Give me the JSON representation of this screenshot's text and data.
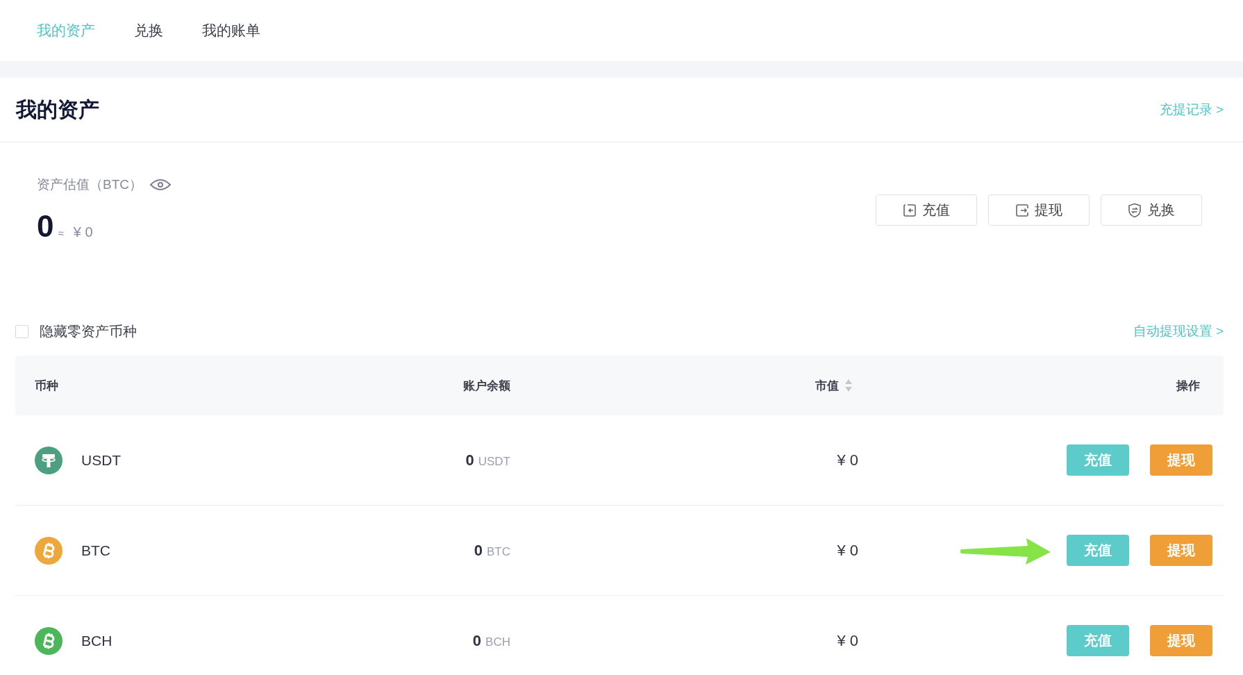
{
  "tabs": [
    {
      "label": "我的资产",
      "selected": true
    },
    {
      "label": "兑换",
      "selected": false
    },
    {
      "label": "我的账单",
      "selected": false
    }
  ],
  "header": {
    "title": "我的资产",
    "link": "充提记录 >"
  },
  "summary": {
    "label": "资产估值（BTC）",
    "amount": "0",
    "approx": "≈",
    "fiat": "¥ 0"
  },
  "actions": [
    {
      "label": "充值",
      "kind": "deposit"
    },
    {
      "label": "提现",
      "kind": "withdraw"
    },
    {
      "label": "兑换",
      "kind": "exchange"
    }
  ],
  "filter": {
    "label": "隐藏零资产币种",
    "checked": false
  },
  "auto_link": "自动提现设置 >",
  "table": {
    "columns": [
      {
        "label": "币种",
        "sortable": false
      },
      {
        "label": "账户余额",
        "sortable": false
      },
      {
        "label": "市值",
        "sortable": true
      },
      {
        "label": "操作",
        "sortable": false
      }
    ],
    "rows": [
      {
        "kind": "tether",
        "color": "#4c9f7f",
        "name": "USDT",
        "balance": "0",
        "unit": "USDT",
        "value": "¥ 0",
        "buttons": [
          {
            "label": "充值",
            "kind": "deposit"
          },
          {
            "label": "提现",
            "kind": "withdraw"
          }
        ]
      },
      {
        "kind": "bitcoin",
        "color": "#eea73b",
        "name": "BTC",
        "balance": "0",
        "unit": "BTC",
        "value": "¥ 0",
        "buttons": [
          {
            "label": "充值",
            "kind": "deposit"
          },
          {
            "label": "提现",
            "kind": "withdraw"
          }
        ]
      },
      {
        "kind": "bitcoin",
        "color": "#4cb65a",
        "name": "BCH",
        "balance": "0",
        "unit": "BCH",
        "value": "¥ 0",
        "buttons": [
          {
            "label": "充值",
            "kind": "deposit"
          },
          {
            "label": "提现",
            "kind": "withdraw"
          }
        ]
      }
    ]
  }
}
